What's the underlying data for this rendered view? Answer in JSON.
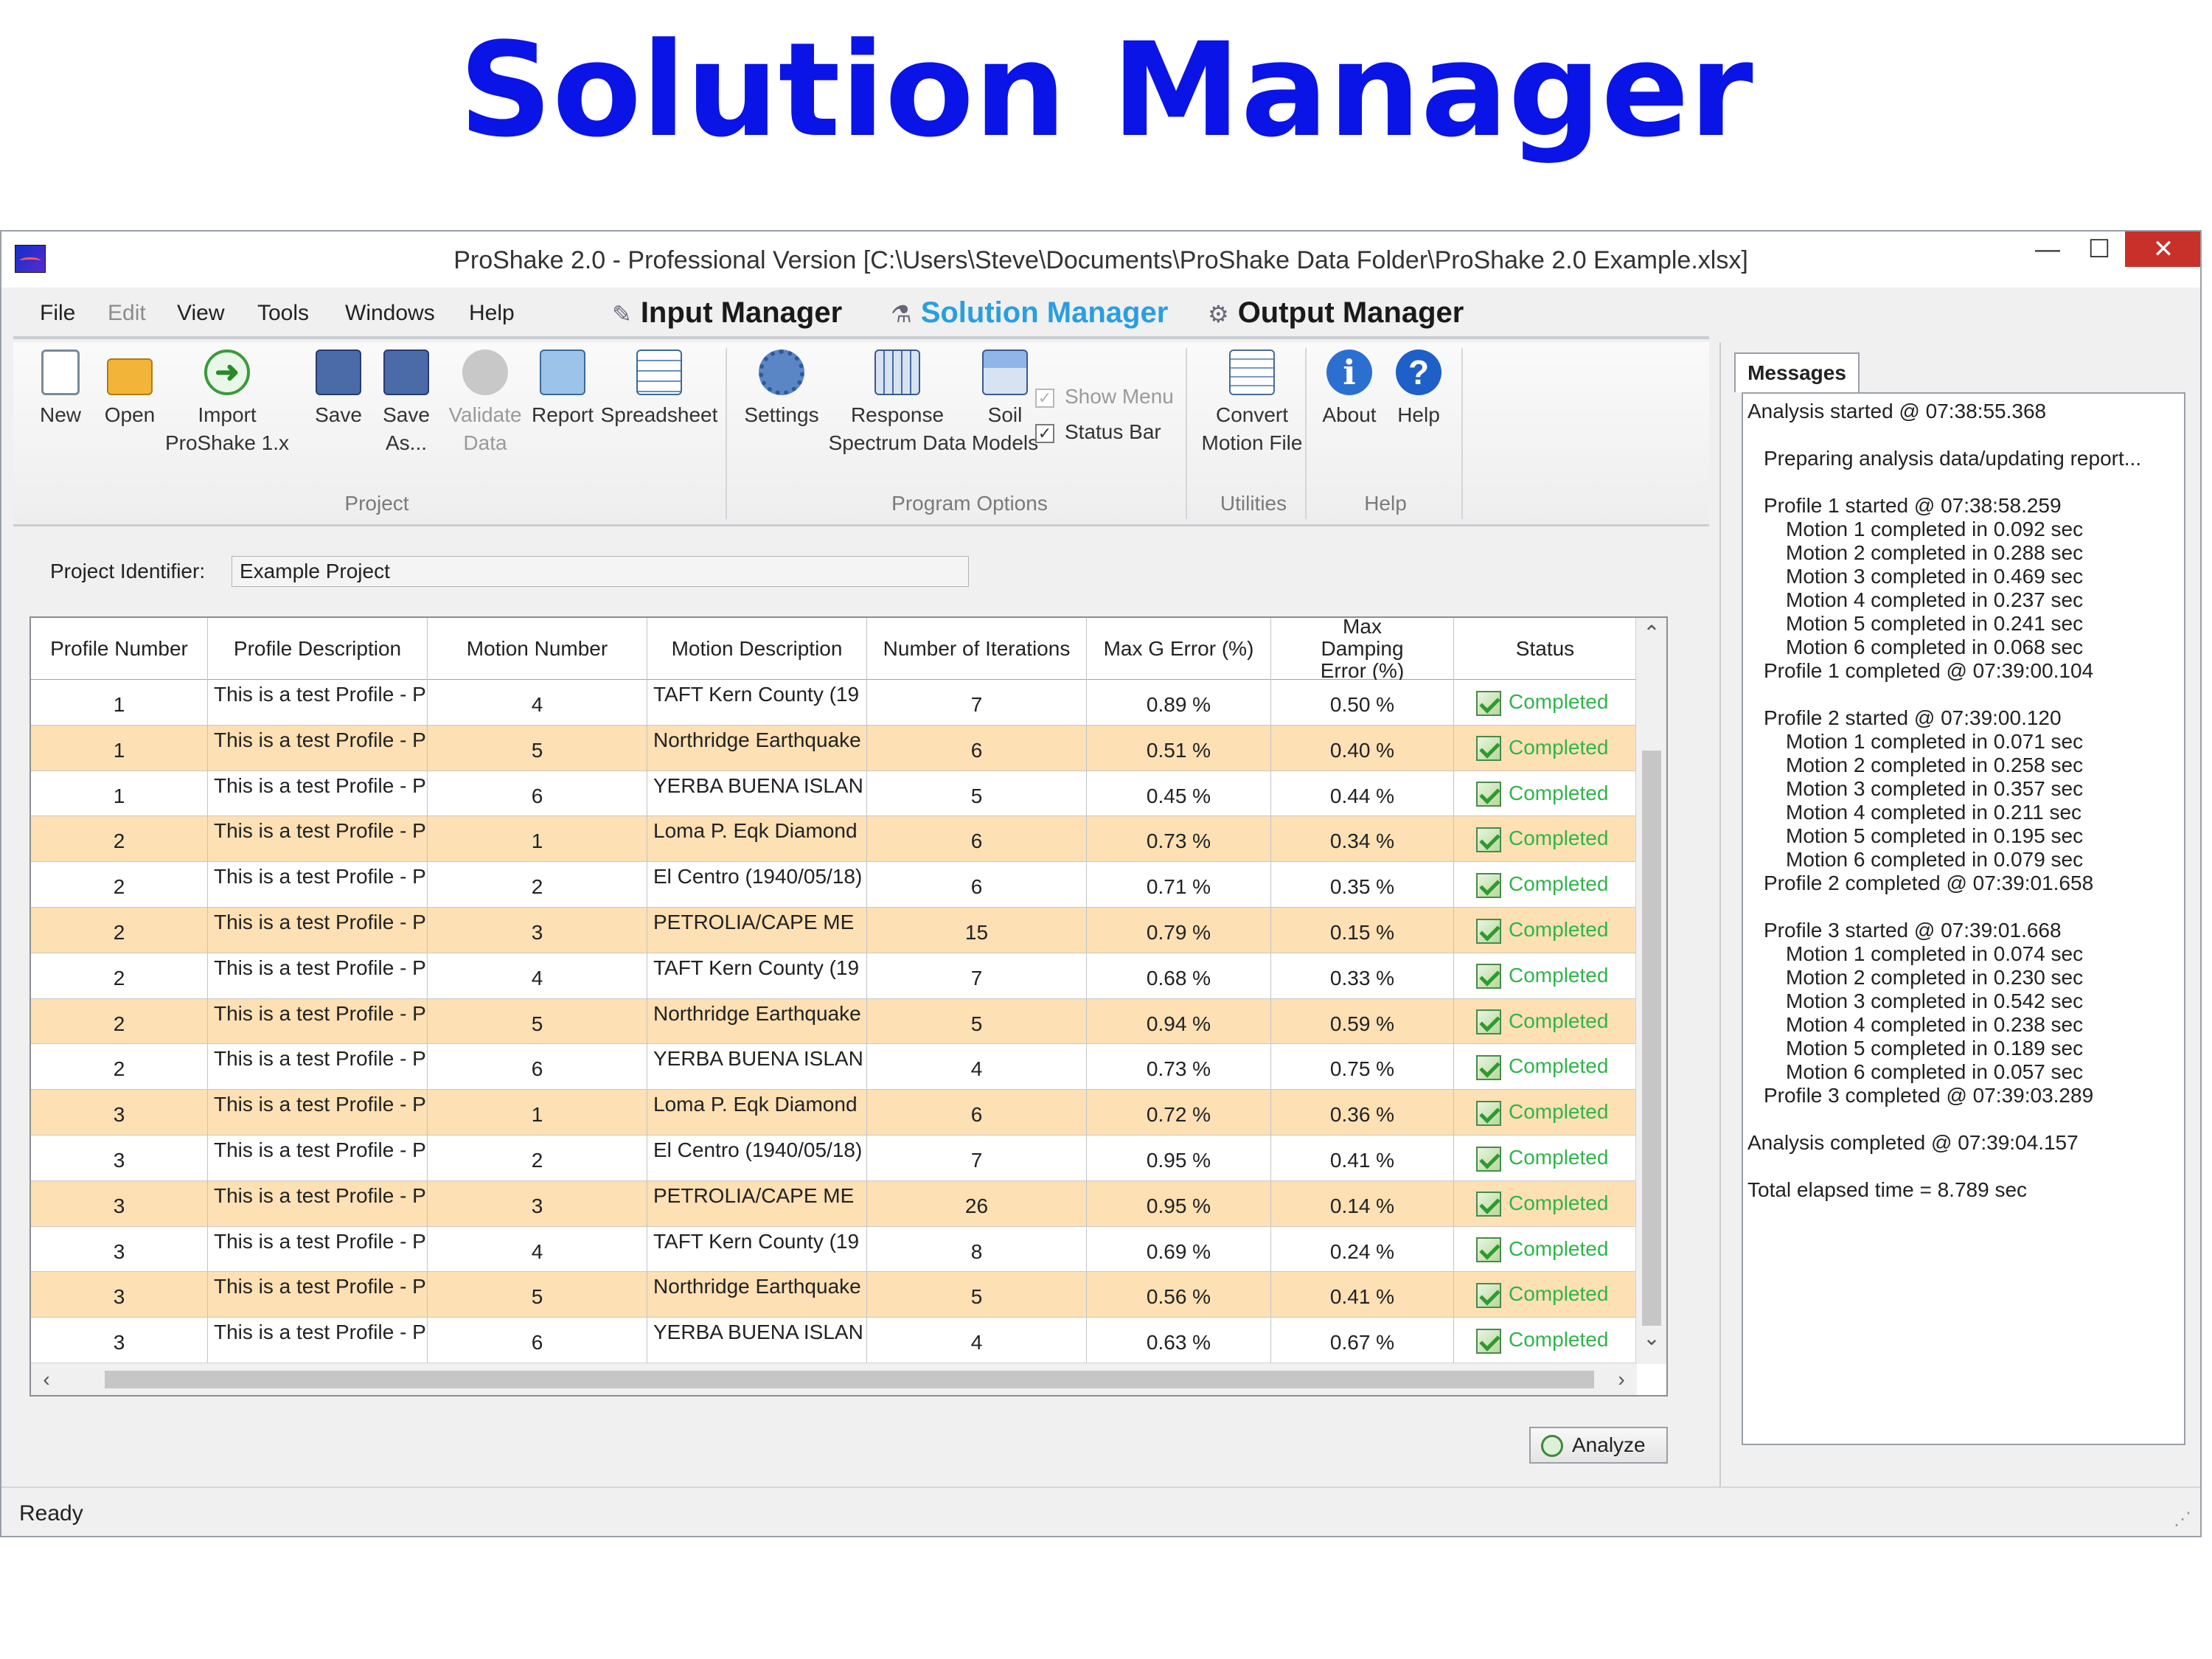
{
  "slide_title": "Solution Manager",
  "window": {
    "title": "ProShake 2.0 - Professional Version [C:\\Users\\Steve\\Documents\\ProShake Data Folder\\ProShake 2.0 Example.xlsx]",
    "minimize": "—",
    "maximize": "☐",
    "close": "✕"
  },
  "menu": {
    "file": "File",
    "edit": "Edit",
    "view": "View",
    "tools": "Tools",
    "windows": "Windows",
    "help": "Help"
  },
  "managers": {
    "input": "Input Manager",
    "solution": "Solution Manager",
    "output": "Output Manager"
  },
  "ribbon": {
    "new": "New",
    "open": "Open",
    "import_l1": "Import",
    "import_l2": "ProShake 1.x",
    "save": "Save",
    "saveas_l1": "Save",
    "saveas_l2": "As...",
    "validate_l1": "Validate",
    "validate_l2": "Data",
    "report": "Report",
    "spreadsheet": "Spreadsheet",
    "settings": "Settings",
    "response_l1": "Response",
    "response_l2": "Spectrum Data",
    "soil_l1": "Soil",
    "soil_l2": "Models",
    "show_menu": "Show Menu",
    "status_bar": "Status Bar",
    "convert_l1": "Convert",
    "convert_l2": "Motion File",
    "about": "About",
    "help": "Help",
    "groups": {
      "project": "Project",
      "program_options": "Program Options",
      "utilities": "Utilities",
      "help": "Help"
    }
  },
  "project": {
    "label": "Project Identifier:",
    "value": "Example Project"
  },
  "grid": {
    "columns": [
      "Profile Number",
      "Profile Description",
      "Motion Number",
      "Motion Description",
      "Number of Iterations",
      "Max G Error (%)",
      "Max Damping Error (%)",
      "Status"
    ],
    "rows": [
      {
        "profile": "1",
        "desc": "This is a test Profile - P",
        "motion": "4",
        "mdesc": "TAFT Kern County (19",
        "iter": "7",
        "g": "0.89 %",
        "d": "0.50 %",
        "status": "Completed"
      },
      {
        "profile": "1",
        "desc": "This is a test Profile - P",
        "motion": "5",
        "mdesc": "Northridge Earthquake",
        "iter": "6",
        "g": "0.51 %",
        "d": "0.40 %",
        "status": "Completed"
      },
      {
        "profile": "1",
        "desc": "This is a test Profile - P",
        "motion": "6",
        "mdesc": "YERBA BUENA ISLAN",
        "iter": "5",
        "g": "0.45 %",
        "d": "0.44 %",
        "status": "Completed"
      },
      {
        "profile": "2",
        "desc": "This is a test Profile - P",
        "motion": "1",
        "mdesc": "Loma P. Eqk Diamond",
        "iter": "6",
        "g": "0.73 %",
        "d": "0.34 %",
        "status": "Completed"
      },
      {
        "profile": "2",
        "desc": "This is a test Profile - P",
        "motion": "2",
        "mdesc": "El Centro (1940/05/18)",
        "iter": "6",
        "g": "0.71 %",
        "d": "0.35 %",
        "status": "Completed"
      },
      {
        "profile": "2",
        "desc": "This is a test Profile - P",
        "motion": "3",
        "mdesc": "PETROLIA/CAPE ME",
        "iter": "15",
        "g": "0.79 %",
        "d": "0.15 %",
        "status": "Completed"
      },
      {
        "profile": "2",
        "desc": "This is a test Profile - P",
        "motion": "4",
        "mdesc": "TAFT Kern County (19",
        "iter": "7",
        "g": "0.68 %",
        "d": "0.33 %",
        "status": "Completed"
      },
      {
        "profile": "2",
        "desc": "This is a test Profile - P",
        "motion": "5",
        "mdesc": "Northridge Earthquake",
        "iter": "5",
        "g": "0.94 %",
        "d": "0.59 %",
        "status": "Completed"
      },
      {
        "profile": "2",
        "desc": "This is a test Profile - P",
        "motion": "6",
        "mdesc": "YERBA BUENA ISLAN",
        "iter": "4",
        "g": "0.73 %",
        "d": "0.75 %",
        "status": "Completed"
      },
      {
        "profile": "3",
        "desc": "This is a test Profile - P",
        "motion": "1",
        "mdesc": "Loma P. Eqk Diamond",
        "iter": "6",
        "g": "0.72 %",
        "d": "0.36 %",
        "status": "Completed"
      },
      {
        "profile": "3",
        "desc": "This is a test Profile - P",
        "motion": "2",
        "mdesc": "El Centro (1940/05/18)",
        "iter": "7",
        "g": "0.95 %",
        "d": "0.41 %",
        "status": "Completed"
      },
      {
        "profile": "3",
        "desc": "This is a test Profile - P",
        "motion": "3",
        "mdesc": "PETROLIA/CAPE ME",
        "iter": "26",
        "g": "0.95 %",
        "d": "0.14 %",
        "status": "Completed"
      },
      {
        "profile": "3",
        "desc": "This is a test Profile - P",
        "motion": "4",
        "mdesc": "TAFT Kern County (19",
        "iter": "8",
        "g": "0.69 %",
        "d": "0.24 %",
        "status": "Completed"
      },
      {
        "profile": "3",
        "desc": "This is a test Profile - P",
        "motion": "5",
        "mdesc": "Northridge Earthquake",
        "iter": "5",
        "g": "0.56 %",
        "d": "0.41 %",
        "status": "Completed"
      },
      {
        "profile": "3",
        "desc": "This is a test Profile - P",
        "motion": "6",
        "mdesc": "YERBA BUENA ISLAN",
        "iter": "4",
        "g": "0.63 %",
        "d": "0.67 %",
        "status": "Completed"
      }
    ]
  },
  "analyze_label": "Analyze",
  "messages": {
    "tab": "Messages",
    "lines": [
      {
        "text": "Analysis started @ 07:38:55.368",
        "indent": 0,
        "gap": false
      },
      {
        "text": "Preparing analysis data/updating report...",
        "indent": 1,
        "gap": true
      },
      {
        "text": "Profile 1 started @ 07:38:58.259",
        "indent": 1,
        "gap": true
      },
      {
        "text": "Motion 1 completed in 0.092 sec",
        "indent": 2,
        "gap": false
      },
      {
        "text": "Motion 2 completed in 0.288 sec",
        "indent": 2,
        "gap": false
      },
      {
        "text": "Motion 3 completed in 0.469 sec",
        "indent": 2,
        "gap": false
      },
      {
        "text": "Motion 4 completed in 0.237 sec",
        "indent": 2,
        "gap": false
      },
      {
        "text": "Motion 5 completed in 0.241 sec",
        "indent": 2,
        "gap": false
      },
      {
        "text": "Motion 6 completed in 0.068 sec",
        "indent": 2,
        "gap": false
      },
      {
        "text": "Profile 1 completed @ 07:39:00.104",
        "indent": 1,
        "gap": false
      },
      {
        "text": "Profile 2 started @ 07:39:00.120",
        "indent": 1,
        "gap": true
      },
      {
        "text": "Motion 1 completed in 0.071 sec",
        "indent": 2,
        "gap": false
      },
      {
        "text": "Motion 2 completed in 0.258 sec",
        "indent": 2,
        "gap": false
      },
      {
        "text": "Motion 3 completed in 0.357 sec",
        "indent": 2,
        "gap": false
      },
      {
        "text": "Motion 4 completed in 0.211 sec",
        "indent": 2,
        "gap": false
      },
      {
        "text": "Motion 5 completed in 0.195 sec",
        "indent": 2,
        "gap": false
      },
      {
        "text": "Motion 6 completed in 0.079 sec",
        "indent": 2,
        "gap": false
      },
      {
        "text": "Profile 2 completed @ 07:39:01.658",
        "indent": 1,
        "gap": false
      },
      {
        "text": "Profile 3 started @ 07:39:01.668",
        "indent": 1,
        "gap": true
      },
      {
        "text": "Motion 1 completed in 0.074 sec",
        "indent": 2,
        "gap": false
      },
      {
        "text": "Motion 2 completed in 0.230 sec",
        "indent": 2,
        "gap": false
      },
      {
        "text": "Motion 3 completed in 0.542 sec",
        "indent": 2,
        "gap": false
      },
      {
        "text": "Motion 4 completed in 0.238 sec",
        "indent": 2,
        "gap": false
      },
      {
        "text": "Motion 5 completed in 0.189 sec",
        "indent": 2,
        "gap": false
      },
      {
        "text": "Motion 6 completed in 0.057 sec",
        "indent": 2,
        "gap": false
      },
      {
        "text": "Profile 3 completed @ 07:39:03.289",
        "indent": 1,
        "gap": false
      },
      {
        "text": "Analysis completed @ 07:39:04.157",
        "indent": 0,
        "gap": true
      },
      {
        "text": "Total elapsed time = 8.789 sec",
        "indent": 0,
        "gap": true
      }
    ]
  },
  "status_bar": "Ready",
  "colors": {
    "slide_title": "#0a14e6",
    "active_manager": "#2a9ee0",
    "row_highlight": "#fde0b4",
    "status_completed": "#2fb54a",
    "close_button": "#c7312a"
  }
}
